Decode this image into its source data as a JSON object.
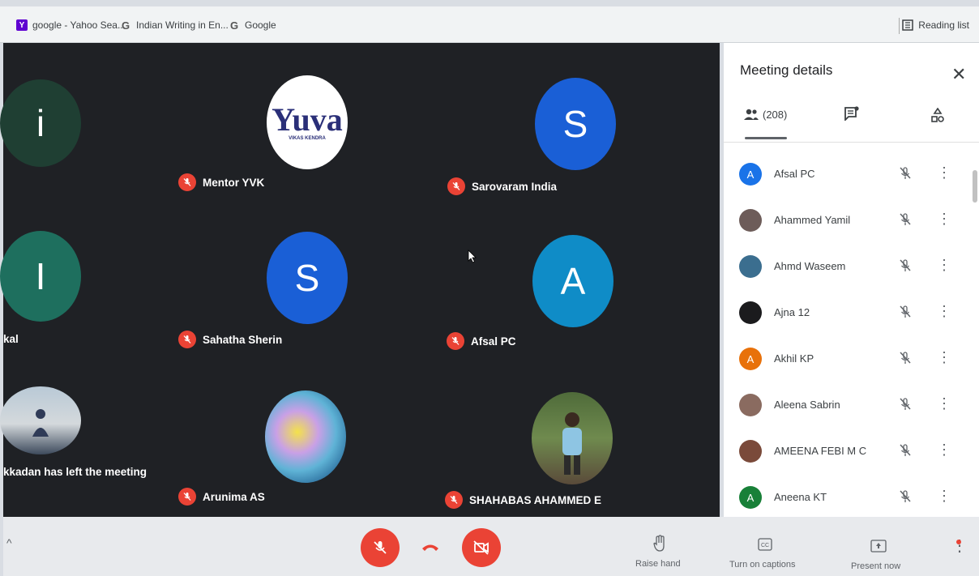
{
  "bookmarks": {
    "items": [
      {
        "label": "google - Yahoo Sea...",
        "icon": "yahoo-icon"
      },
      {
        "label": "Indian Writing in En...",
        "icon": "google-icon"
      },
      {
        "label": "Google",
        "icon": "google-icon"
      }
    ],
    "reading_list": "Reading list"
  },
  "tiles": {
    "t1_letter": "i",
    "t2_name": "Mentor YVK",
    "t2_logo": "Yuva",
    "t2_logo_sub": "VIKAS KENDRA",
    "t3_letter": "S",
    "t3_name": "Sarovaram India",
    "t4_letter": "I",
    "t4_partial_name": "kal",
    "t5_letter": "S",
    "t5_name": "Sahatha Sherin",
    "t6_letter": "A",
    "t6_name": "Afsal PC",
    "t7_left_note": "kkadan has left the meeting",
    "t8_name": "Arunima AS",
    "t9_name": "SHAHABAS AHAMMED E"
  },
  "panel": {
    "title": "Meeting details",
    "people_count": "(208)",
    "participants": [
      {
        "name": "Afsal PC",
        "initial": "A",
        "color": "#1a73e8"
      },
      {
        "name": "Ahammed Yamil",
        "initial": "",
        "color": "#6d5c59"
      },
      {
        "name": "Ahmd Waseem",
        "initial": "",
        "color": "#3b6e8f"
      },
      {
        "name": "Ajna 12",
        "initial": "",
        "color": "#1b1b1d"
      },
      {
        "name": "Akhil KP",
        "initial": "A",
        "color": "#e8710a"
      },
      {
        "name": "Aleena Sabrin",
        "initial": "",
        "color": "#8a6b60"
      },
      {
        "name": "AMEENA FEBI M C",
        "initial": "",
        "color": "#7a4a3a"
      },
      {
        "name": "Aneena KT",
        "initial": "A",
        "color": "#188038"
      }
    ]
  },
  "controls": {
    "raise_hand": "Raise hand",
    "captions": "Turn on captions",
    "present": "Present now"
  },
  "colors": {
    "mic_off_red": "#ea4335",
    "stage_bg": "#1f2125"
  }
}
